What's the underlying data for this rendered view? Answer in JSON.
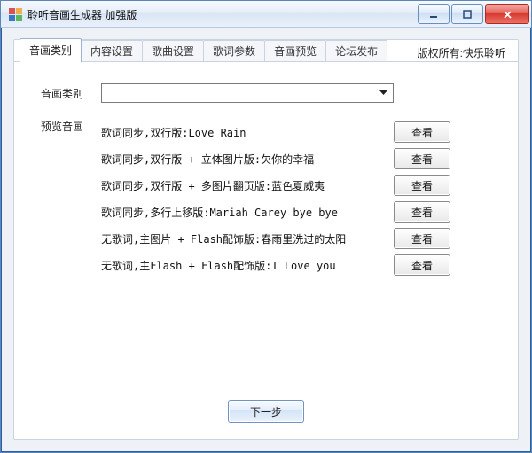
{
  "window": {
    "title": "聆听音画生成器 加强版"
  },
  "tabs": [
    {
      "label": "音画类别",
      "active": true
    },
    {
      "label": "内容设置",
      "active": false
    },
    {
      "label": "歌曲设置",
      "active": false
    },
    {
      "label": "歌词参数",
      "active": false
    },
    {
      "label": "音画预览",
      "active": false
    },
    {
      "label": "论坛发布",
      "active": false
    }
  ],
  "copyright": "版权所有:快乐聆听",
  "form": {
    "category_label": "音画类别",
    "category_value": "",
    "preview_label": "预览音画",
    "view_button": "查看",
    "next_button": "下一步"
  },
  "items": [
    "歌词同步,双行版:Love Rain",
    "歌词同步,双行版 + 立体图片版:欠你的幸福",
    "歌词同步,双行版 + 多图片翻页版:蓝色夏威夷",
    "歌词同步,多行上移版:Mariah Carey bye bye",
    "无歌词,主图片 + Flash配饰版:春雨里洗过的太阳",
    "无歌词,主Flash + Flash配饰版:I Love you"
  ]
}
